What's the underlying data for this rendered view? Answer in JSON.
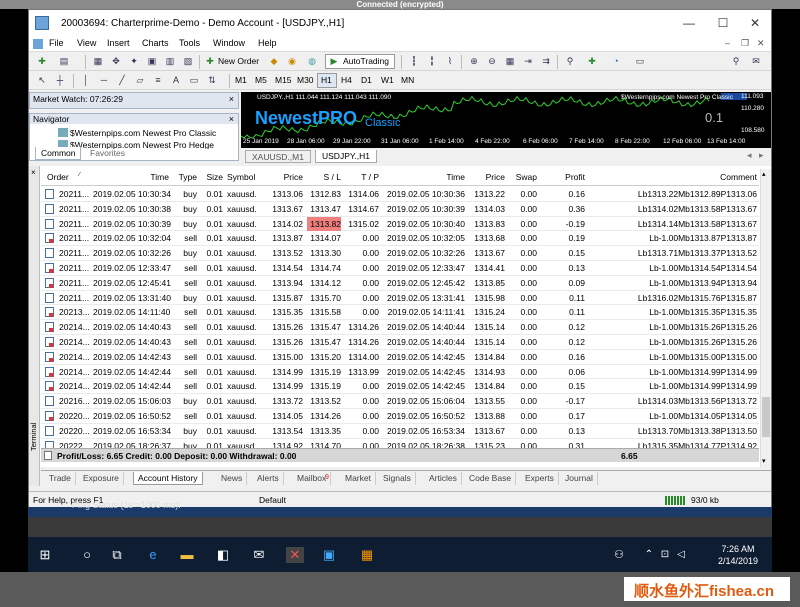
{
  "rdp_title": "Connected (encrypted)",
  "window": {
    "title": "20003694: Charterprime-Demo - Demo Account - [USDJPY.,H1]",
    "min": "—",
    "max": "☐",
    "close": "✕"
  },
  "menu": [
    "File",
    "View",
    "Insert",
    "Charts",
    "Tools",
    "Window",
    "Help"
  ],
  "toolbar": {
    "new_order": "New Order",
    "autotrading": "AutoTrading",
    "timeframes": [
      "M1",
      "M5",
      "M15",
      "M30",
      "H1",
      "H4",
      "D1",
      "W1",
      "MN"
    ]
  },
  "market_watch": {
    "title": "Market Watch: 07:26:29"
  },
  "navigator": {
    "title": "Navigator",
    "items": [
      "$Westernpips.com Newest Pro Classic",
      "$Westernpips.com Newest Pro Hedge"
    ],
    "tabs": [
      "Common",
      "Favorites"
    ]
  },
  "chart": {
    "header": "USDJPY.,H1  111.044 111.124 111.043 111.090",
    "watermark": "$Westernpips.com Newest Pro Classic",
    "brand_big": "NewestPRO",
    "brand_small": "Classic",
    "value_box": "0.1",
    "prices": [
      "111.093",
      "110.280",
      "108.580"
    ],
    "dates": [
      "25 Jan 2019",
      "28 Jan 06:00",
      "29 Jan 22:00",
      "31 Jan 06:00",
      "1 Feb 14:00",
      "4 Feb 22:00",
      "6 Feb 06:00",
      "7 Feb 14:00",
      "8 Feb 22:00",
      "12 Feb 06:00",
      "13 Feb 14:00"
    ],
    "tabs": [
      "XAUUSD.,M1",
      "USDJPY.,H1"
    ],
    "active_tab": 1
  },
  "grid": {
    "headers": [
      "Order",
      "Time",
      "Type",
      "Size",
      "Symbol",
      "Price",
      "S / L",
      "T / P",
      "Time",
      "Price",
      "Swap",
      "Profit",
      "Comment"
    ],
    "rows": [
      [
        "20211...",
        "2019.02.05 10:30:34",
        "buy",
        "0.01",
        "xauusd.",
        "1313.06",
        "1312.83",
        "1314.06",
        "2019.02.05 10:30:36",
        "1313.22",
        "0.00",
        "0.16",
        "Lb1313.22Mb1312.89P1313.06"
      ],
      [
        "20211...",
        "2019.02.05 10:30:38",
        "buy",
        "0.01",
        "xauusd.",
        "1313.67",
        "1313.47",
        "1314.67",
        "2019.02.05 10:30:39",
        "1314.03",
        "0.00",
        "0.36",
        "Lb1314.02Mb1313.58P1313.67"
      ],
      [
        "20211...",
        "2019.02.05 10:30:39",
        "buy",
        "0.01",
        "xauusd.",
        "1314.02",
        "1313.82",
        "1315.02",
        "2019.02.05 10:30:40",
        "1313.83",
        "0.00",
        "-0.19",
        "Lb1314.14Mb1313.58P1313.67"
      ],
      [
        "20211...",
        "2019.02.05 10:32:04",
        "sell",
        "0.01",
        "xauusd.",
        "1313.87",
        "1314.07",
        "0.00",
        "2019.02.05 10:32:05",
        "1313.68",
        "0.00",
        "0.19",
        "Lb-1.00Mb1313.87P1313.87"
      ],
      [
        "20211...",
        "2019.02.05 10:32:26",
        "buy",
        "0.01",
        "xauusd.",
        "1313.52",
        "1313.30",
        "0.00",
        "2019.02.05 10:32:26",
        "1313.67",
        "0.00",
        "0.15",
        "Lb1313.71Mb1313.37P1313.52"
      ],
      [
        "20211...",
        "2019.02.05 12:33:47",
        "sell",
        "0.01",
        "xauusd.",
        "1314.54",
        "1314.74",
        "0.00",
        "2019.02.05 12:33:47",
        "1314.41",
        "0.00",
        "0.13",
        "Lb-1.00Mb1314.54P1314.54"
      ],
      [
        "20211...",
        "2019.02.05 12:45:41",
        "sell",
        "0.01",
        "xauusd.",
        "1313.94",
        "1314.12",
        "0.00",
        "2019.02.05 12:45:42",
        "1313.85",
        "0.00",
        "0.09",
        "Lb-1.00Mb1313.94P1313.94"
      ],
      [
        "20211...",
        "2019.02.05 13:31:40",
        "buy",
        "0.01",
        "xauusd.",
        "1315.87",
        "1315.70",
        "0.00",
        "2019.02.05 13:31:41",
        "1315.98",
        "0.00",
        "0.11",
        "Lb1316.02Mb1315.76P1315.87"
      ],
      [
        "20213...",
        "2019.02.05 14:11:40",
        "sell",
        "0.01",
        "xauusd.",
        "1315.35",
        "1315.58",
        "0.00",
        "2019.02.05 14:11:41",
        "1315.24",
        "0.00",
        "0.11",
        "Lb-1.00Mb1315.35P1315.35"
      ],
      [
        "20214...",
        "2019.02.05 14:40:43",
        "sell",
        "0.01",
        "xauusd.",
        "1315.26",
        "1315.47",
        "1314.26",
        "2019.02.05 14:40:44",
        "1315.14",
        "0.00",
        "0.12",
        "Lb-1.00Mb1315.26P1315.26"
      ],
      [
        "20214...",
        "2019.02.05 14:40:43",
        "sell",
        "0.01",
        "xauusd.",
        "1315.26",
        "1315.47",
        "1314.26",
        "2019.02.05 14:40:44",
        "1315.14",
        "0.00",
        "0.12",
        "Lb-1.00Mb1315.26P1315.26"
      ],
      [
        "20214...",
        "2019.02.05 14:42:43",
        "sell",
        "0.01",
        "xauusd.",
        "1315.00",
        "1315.20",
        "1314.00",
        "2019.02.05 14:42:45",
        "1314.84",
        "0.00",
        "0.16",
        "Lb-1.00Mb1315.00P1315.00"
      ],
      [
        "20214...",
        "2019.02.05 14:42:44",
        "sell",
        "0.01",
        "xauusd.",
        "1314.99",
        "1315.19",
        "1313.99",
        "2019.02.05 14:42:45",
        "1314.93",
        "0.00",
        "0.06",
        "Lb-1.00Mb1314.99P1314.99"
      ],
      [
        "20214...",
        "2019.02.05 14:42:44",
        "sell",
        "0.01",
        "xauusd.",
        "1314.99",
        "1315.19",
        "0.00",
        "2019.02.05 14:42:45",
        "1314.84",
        "0.00",
        "0.15",
        "Lb-1.00Mb1314.99P1314.99"
      ],
      [
        "20216...",
        "2019.02.05 15:06:03",
        "buy",
        "0.01",
        "xauusd.",
        "1313.72",
        "1313.52",
        "0.00",
        "2019.02.05 15:06:04",
        "1313.55",
        "0.00",
        "-0.17",
        "Lb1314.03Mb1313.56P1313.72"
      ],
      [
        "20220...",
        "2019.02.05 16:50:52",
        "sell",
        "0.01",
        "xauusd.",
        "1314.05",
        "1314.26",
        "0.00",
        "2019.02.05 16:50:52",
        "1313.88",
        "0.00",
        "0.17",
        "Lb-1.00Mb1314.05P1314.05"
      ],
      [
        "20220...",
        "2019.02.05 16:53:34",
        "buy",
        "0.01",
        "xauusd.",
        "1313.54",
        "1313.35",
        "0.00",
        "2019.02.05 16:53:34",
        "1313.67",
        "0.00",
        "0.13",
        "Lb1313.70Mb1313.38P1313.50"
      ],
      [
        "20222...",
        "2019.02.05 18:26:37",
        "buy",
        "0.01",
        "xauusd.",
        "1314.92",
        "1314.70",
        "0.00",
        "2019.02.05 18:26:38",
        "1315.23",
        "0.00",
        "0.31",
        "Lb1315.35Mb1314.77P1314.92"
      ]
    ],
    "highlight": {
      "row": 2,
      "col": 6,
      "color": "#f08080"
    },
    "total_label": "Profit/Loss: 6.65  Credit: 0.00  Deposit: 0.00  Withdrawal: 0.00",
    "total_value": "6.65"
  },
  "term_label": "Terminal",
  "bottom_tabs": [
    "Trade",
    "Exposure",
    "Account History",
    "News",
    "Alerts",
    "Mailbox",
    "Market",
    "Signals",
    "Articles",
    "Code Base",
    "Experts",
    "Journal"
  ],
  "bottom_active": 2,
  "mailbox_badge": "9",
  "status": {
    "help": "For Help, press F1",
    "profile": "Default",
    "traffic": "93/0 kb"
  },
  "behind_text": "Ping Status (1s =1000 ms):",
  "taskbar": {
    "time": "7:26 AM",
    "date": "2/14/2019"
  },
  "watermark": "顺水鱼外汇fishea.cn"
}
